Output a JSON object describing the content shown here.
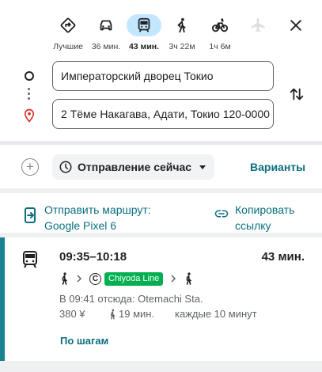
{
  "modes": [
    {
      "label": "Лучшие",
      "icon": "best-route-icon"
    },
    {
      "label": "36 мин.",
      "icon": "car-icon"
    },
    {
      "label": "43 мин.",
      "icon": "transit-icon",
      "active": true
    },
    {
      "label": "3ч 22м",
      "icon": "walk-icon"
    },
    {
      "label": "1ч 6м",
      "icon": "bicycle-icon"
    },
    {
      "label": "",
      "icon": "flight-icon",
      "disabled": true
    }
  ],
  "close_icon": "close-icon",
  "origin": "Императорский дворец Токио",
  "destination": "2 Тёме Накагава, Адати, Токио 120-0000",
  "depart": {
    "label": "Отправление сейчас"
  },
  "options_label": "Варианты",
  "share": {
    "send_line1": "Отправить маршрут:",
    "send_line2": "Google Pixel 6",
    "copy_line1": "Копировать",
    "copy_line2": "ссылку"
  },
  "route": {
    "time_range": "09:35–10:18",
    "duration": "43 мин.",
    "line_logo": "C",
    "line_name": "Chiyoda Line",
    "line_color": "#00b050",
    "departure_info": "В 09:41 отсюда: Otemachi Sta.",
    "fare": "380 ¥",
    "walk": "19 мин.",
    "frequency": "каждые 10 минут",
    "details_label": "По шагам"
  },
  "colors": {
    "accent": "#0b6f80",
    "active_mode_bg": "#c2e7ff",
    "route_bar": "#1a8290"
  }
}
